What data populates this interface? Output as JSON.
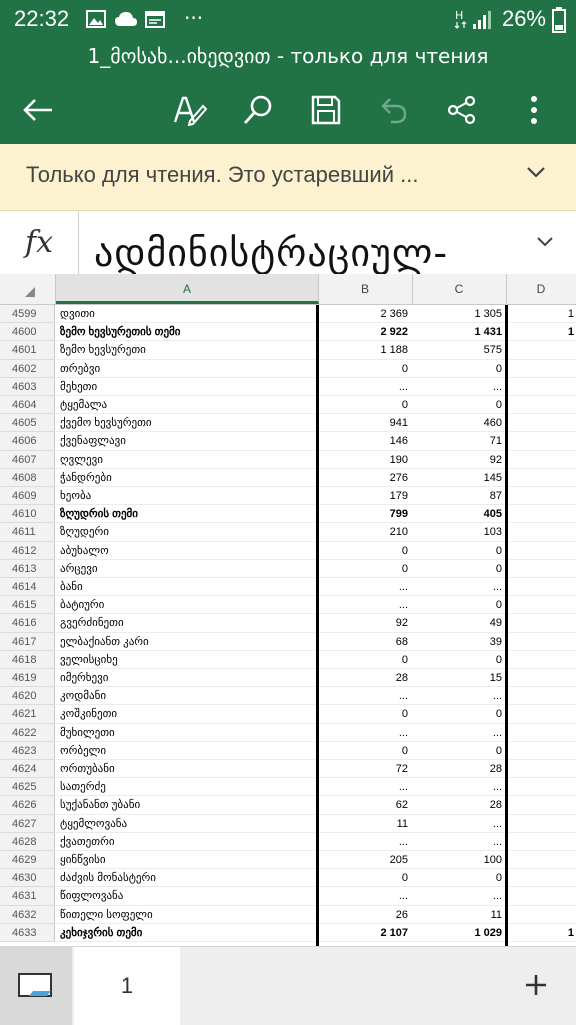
{
  "status": {
    "time": "22:32",
    "battery": "26%"
  },
  "title": "1_მოსახ...იხედვით - только для чтения",
  "banner": {
    "message": "Только для чтения. Это устаревший ..."
  },
  "formula": {
    "fx": "fx",
    "text": "ადმინისტრაციულ-"
  },
  "columns": [
    "A",
    "B",
    "C",
    "D"
  ],
  "rows": [
    {
      "n": "4599",
      "a": "დვითი",
      "b": "2 369",
      "c": "1 305",
      "d": "1",
      "bold": false
    },
    {
      "n": "4600",
      "a": "ზემო ხევსურეთის თემი",
      "b": "2 922",
      "c": "1 431",
      "d": "1",
      "bold": true
    },
    {
      "n": "4601",
      "a": "ზემო ხევსურეთი",
      "b": "1 188",
      "c": "575",
      "d": "",
      "bold": false
    },
    {
      "n": "4602",
      "a": "თრებვი",
      "b": "0",
      "c": "0",
      "d": "",
      "bold": false
    },
    {
      "n": "4603",
      "a": "მეხეთი",
      "b": "...",
      "c": "...",
      "d": "",
      "bold": false
    },
    {
      "n": "4604",
      "a": "ტყემალა",
      "b": "0",
      "c": "0",
      "d": "",
      "bold": false
    },
    {
      "n": "4605",
      "a": "ქვემო ხევსურეთი",
      "b": "941",
      "c": "460",
      "d": "",
      "bold": false
    },
    {
      "n": "4606",
      "a": "ქვენაფლავი",
      "b": "146",
      "c": "71",
      "d": "",
      "bold": false
    },
    {
      "n": "4607",
      "a": "ღვლევი",
      "b": "190",
      "c": "92",
      "d": "",
      "bold": false
    },
    {
      "n": "4608",
      "a": "ჭანდრები",
      "b": "276",
      "c": "145",
      "d": "",
      "bold": false
    },
    {
      "n": "4609",
      "a": "ხეობა",
      "b": "179",
      "c": "87",
      "d": "",
      "bold": false
    },
    {
      "n": "4610",
      "a": "ზღუდრის თემი",
      "b": "799",
      "c": "405",
      "d": "",
      "bold": true
    },
    {
      "n": "4611",
      "a": "ზღუდერი",
      "b": "210",
      "c": "103",
      "d": "",
      "bold": false
    },
    {
      "n": "4612",
      "a": "აბუხალო",
      "b": "0",
      "c": "0",
      "d": "",
      "bold": false
    },
    {
      "n": "4613",
      "a": "არცევი",
      "b": "0",
      "c": "0",
      "d": "",
      "bold": false
    },
    {
      "n": "4614",
      "a": "ბანი",
      "b": "...",
      "c": "...",
      "d": "",
      "bold": false
    },
    {
      "n": "4615",
      "a": "ბატიური",
      "b": "...",
      "c": "0",
      "d": "",
      "bold": false
    },
    {
      "n": "4616",
      "a": "გვერძინეთი",
      "b": "92",
      "c": "49",
      "d": "",
      "bold": false
    },
    {
      "n": "4617",
      "a": "ელბაქიანთ კარი",
      "b": "68",
      "c": "39",
      "d": "",
      "bold": false
    },
    {
      "n": "4618",
      "a": "ველისციხე",
      "b": "0",
      "c": "0",
      "d": "",
      "bold": false
    },
    {
      "n": "4619",
      "a": "იმერხევი",
      "b": "28",
      "c": "15",
      "d": "",
      "bold": false
    },
    {
      "n": "4620",
      "a": "კოდმანი",
      "b": "...",
      "c": "...",
      "d": "",
      "bold": false
    },
    {
      "n": "4621",
      "a": "კოშკინეთი",
      "b": "0",
      "c": "0",
      "d": "",
      "bold": false
    },
    {
      "n": "4622",
      "a": "მუხილეთი",
      "b": "...",
      "c": "...",
      "d": "",
      "bold": false
    },
    {
      "n": "4623",
      "a": "ორბელი",
      "b": "0",
      "c": "0",
      "d": "",
      "bold": false
    },
    {
      "n": "4624",
      "a": "ორთუბანი",
      "b": "72",
      "c": "28",
      "d": "",
      "bold": false
    },
    {
      "n": "4625",
      "a": "სათერძე",
      "b": "...",
      "c": "...",
      "d": "",
      "bold": false
    },
    {
      "n": "4626",
      "a": "სუქანანთ უბანი",
      "b": "62",
      "c": "28",
      "d": "",
      "bold": false
    },
    {
      "n": "4627",
      "a": "ტყემლოვანა",
      "b": "11",
      "c": "...",
      "d": "",
      "bold": false
    },
    {
      "n": "4628",
      "a": "ქვათეთრი",
      "b": "...",
      "c": "...",
      "d": "",
      "bold": false
    },
    {
      "n": "4629",
      "a": "ყინწვისი",
      "b": "205",
      "c": "100",
      "d": "",
      "bold": false
    },
    {
      "n": "4630",
      "a": "ძაძვის მონასტერი",
      "b": "0",
      "c": "0",
      "d": "",
      "bold": false
    },
    {
      "n": "4631",
      "a": "წიფლოვანა",
      "b": "...",
      "c": "...",
      "d": "",
      "bold": false
    },
    {
      "n": "4632",
      "a": "წითელი სოფელი",
      "b": "26",
      "c": "11",
      "d": "",
      "bold": false
    },
    {
      "n": "4633",
      "a": "კეხიჯვრის თემი",
      "b": "2 107",
      "c": "1 029",
      "d": "1",
      "bold": true
    }
  ],
  "sheet": {
    "tab_label": "1"
  },
  "icons": {
    "back": "arrow-left-icon",
    "edit": "pen-edit-icon",
    "search": "search-icon",
    "save": "save-icon",
    "undo": "undo-icon",
    "share": "share-icon",
    "more": "more-vertical-icon"
  },
  "colors": {
    "brand": "#217346",
    "banner": "#fcf2cf"
  }
}
